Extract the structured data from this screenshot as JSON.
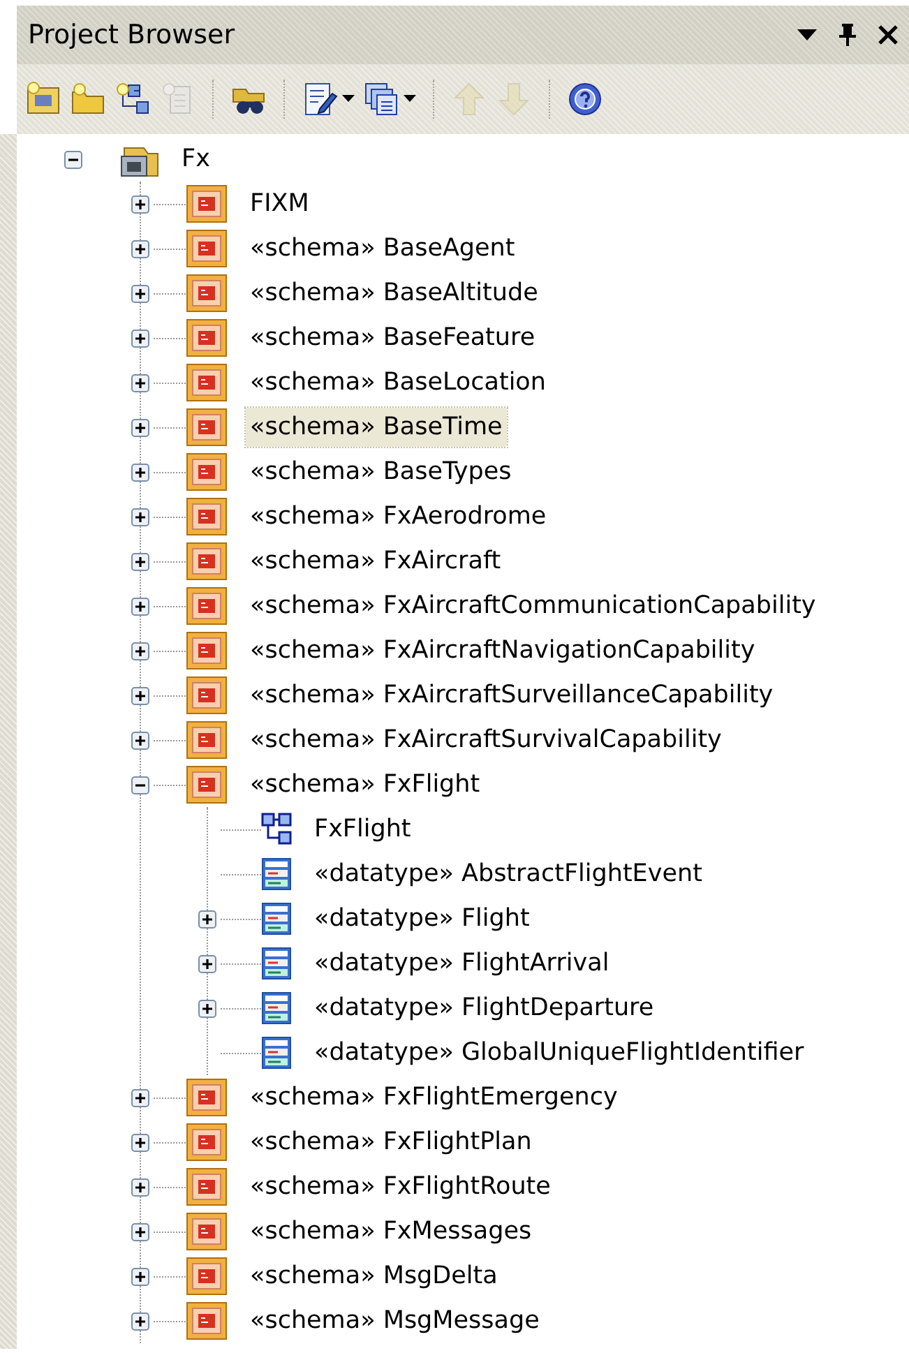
{
  "window": {
    "title": "Project Browser"
  },
  "toolbar": [
    {
      "kind": "new-model",
      "disabled": false
    },
    {
      "kind": "new-package",
      "disabled": false
    },
    {
      "kind": "new-diagram",
      "disabled": false
    },
    {
      "kind": "new-element",
      "disabled": true
    },
    {
      "kind": "separator"
    },
    {
      "kind": "find",
      "disabled": false
    },
    {
      "kind": "separator"
    },
    {
      "kind": "properties",
      "disabled": false,
      "dropdown": true
    },
    {
      "kind": "windows",
      "disabled": false,
      "dropdown": true
    },
    {
      "kind": "separator"
    },
    {
      "kind": "move-up",
      "disabled": true
    },
    {
      "kind": "move-down",
      "disabled": true
    },
    {
      "kind": "separator"
    },
    {
      "kind": "help",
      "disabled": false
    }
  ],
  "tree": {
    "label": "Fx",
    "kind": "root",
    "expanded": true,
    "selected": false,
    "children": [
      {
        "label": "FIXM",
        "kind": "package",
        "expanded": false,
        "selected": false
      },
      {
        "label": "«schema» BaseAgent",
        "kind": "package",
        "expanded": false,
        "selected": false
      },
      {
        "label": "«schema» BaseAltitude",
        "kind": "package",
        "expanded": false,
        "selected": false
      },
      {
        "label": "«schema» BaseFeature",
        "kind": "package",
        "expanded": false,
        "selected": false
      },
      {
        "label": "«schema» BaseLocation",
        "kind": "package",
        "expanded": false,
        "selected": false
      },
      {
        "label": "«schema» BaseTime",
        "kind": "package",
        "expanded": false,
        "selected": true
      },
      {
        "label": "«schema» BaseTypes",
        "kind": "package",
        "expanded": false,
        "selected": false
      },
      {
        "label": "«schema» FxAerodrome",
        "kind": "package",
        "expanded": false,
        "selected": false
      },
      {
        "label": "«schema» FxAircraft",
        "kind": "package",
        "expanded": false,
        "selected": false
      },
      {
        "label": "«schema» FxAircraftCommunicationCapability",
        "kind": "package",
        "expanded": false,
        "selected": false
      },
      {
        "label": "«schema» FxAircraftNavigationCapability",
        "kind": "package",
        "expanded": false,
        "selected": false
      },
      {
        "label": "«schema» FxAircraftSurveillanceCapability",
        "kind": "package",
        "expanded": false,
        "selected": false
      },
      {
        "label": "«schema» FxAircraftSurvivalCapability",
        "kind": "package",
        "expanded": false,
        "selected": false
      },
      {
        "label": "«schema» FxFlight",
        "kind": "package",
        "expanded": true,
        "selected": false,
        "children": [
          {
            "label": "FxFlight",
            "kind": "diagram",
            "selected": false
          },
          {
            "label": "«datatype» AbstractFlightEvent",
            "kind": "datatype",
            "selected": false
          },
          {
            "label": "«datatype» Flight",
            "kind": "datatype",
            "expanded": false,
            "selected": false
          },
          {
            "label": "«datatype» FlightArrival",
            "kind": "datatype",
            "expanded": false,
            "selected": false
          },
          {
            "label": "«datatype» FlightDeparture",
            "kind": "datatype",
            "expanded": false,
            "selected": false
          },
          {
            "label": "«datatype» GlobalUniqueFlightIdentifier",
            "kind": "datatype",
            "selected": false
          }
        ]
      },
      {
        "label": "«schema» FxFlightEmergency",
        "kind": "package",
        "expanded": false,
        "selected": false
      },
      {
        "label": "«schema» FxFlightPlan",
        "kind": "package",
        "expanded": false,
        "selected": false
      },
      {
        "label": "«schema» FxFlightRoute",
        "kind": "package",
        "expanded": false,
        "selected": false
      },
      {
        "label": "«schema» FxMessages",
        "kind": "package",
        "expanded": false,
        "selected": false
      },
      {
        "label": "«schema» MsgDelta",
        "kind": "package",
        "expanded": false,
        "selected": false
      },
      {
        "label": "«schema» MsgMessage",
        "kind": "package",
        "expanded": false,
        "selected": false
      }
    ]
  }
}
